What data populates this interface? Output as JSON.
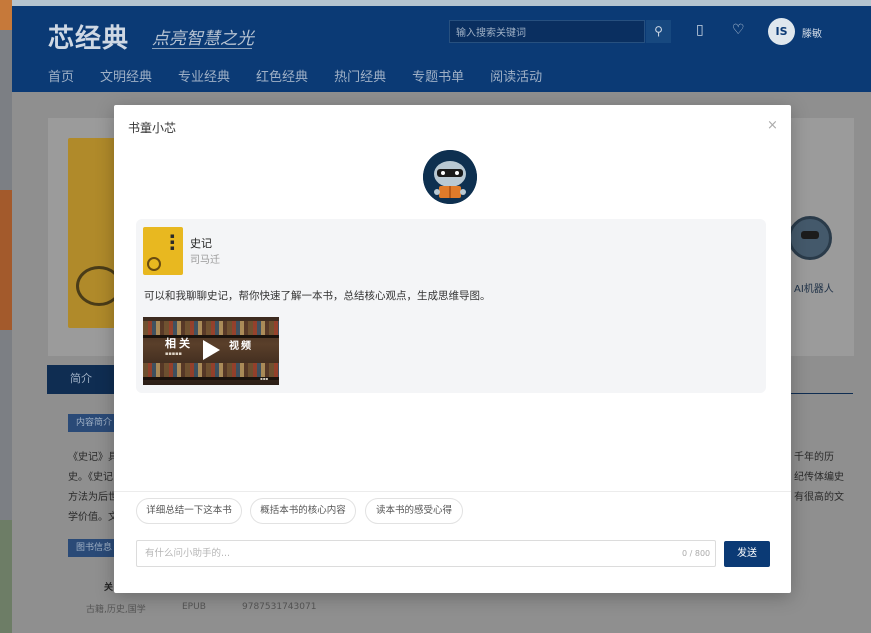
{
  "header": {
    "logo": "芯经典",
    "slogan": "点亮智慧之光",
    "search_placeholder": "输入搜索关键词",
    "search_icon": "search-icon",
    "username": "滕敏",
    "avatar_text": "IS"
  },
  "nav": {
    "items": [
      "首页",
      "文明经典",
      "专业经典",
      "红色经典",
      "热门经典",
      "专题书单",
      "阅读活动"
    ]
  },
  "background_page": {
    "ai_label": "AI机器人",
    "tab_intro": "简介",
    "tag_content": "内容简介",
    "tag_info": "图书信息",
    "text_left": [
      "《史记》具",
      "史。《史记",
      "方法为后世",
      "学价值。文"
    ],
    "text_right": [
      "千年的历",
      "纪传体编史",
      "有很高的文"
    ],
    "meta_label": "关",
    "meta_values": [
      "古籍,历史,国学",
      "EPUB",
      "9787531743071"
    ]
  },
  "modal": {
    "title": "书童小芯",
    "close_glyph": "×",
    "book_title": "史记",
    "book_author": "司马迁",
    "message": "可以和我聊聊史记，帮你快速了解一本书，总结核心观点，生成思维导图。",
    "video_caption_left": "相关",
    "video_caption_right": "视频",
    "chips": [
      "详细总结一下这本书",
      "概括本书的核心内容",
      "读本书的感受心得"
    ],
    "input_placeholder": "有什么问小助手的...",
    "counter": "0 / 800",
    "send_label": "发送"
  },
  "colors": {
    "brand_blue": "#0b3a75",
    "book_yellow": "#e8b820",
    "message_bg": "#f4f5f7"
  }
}
